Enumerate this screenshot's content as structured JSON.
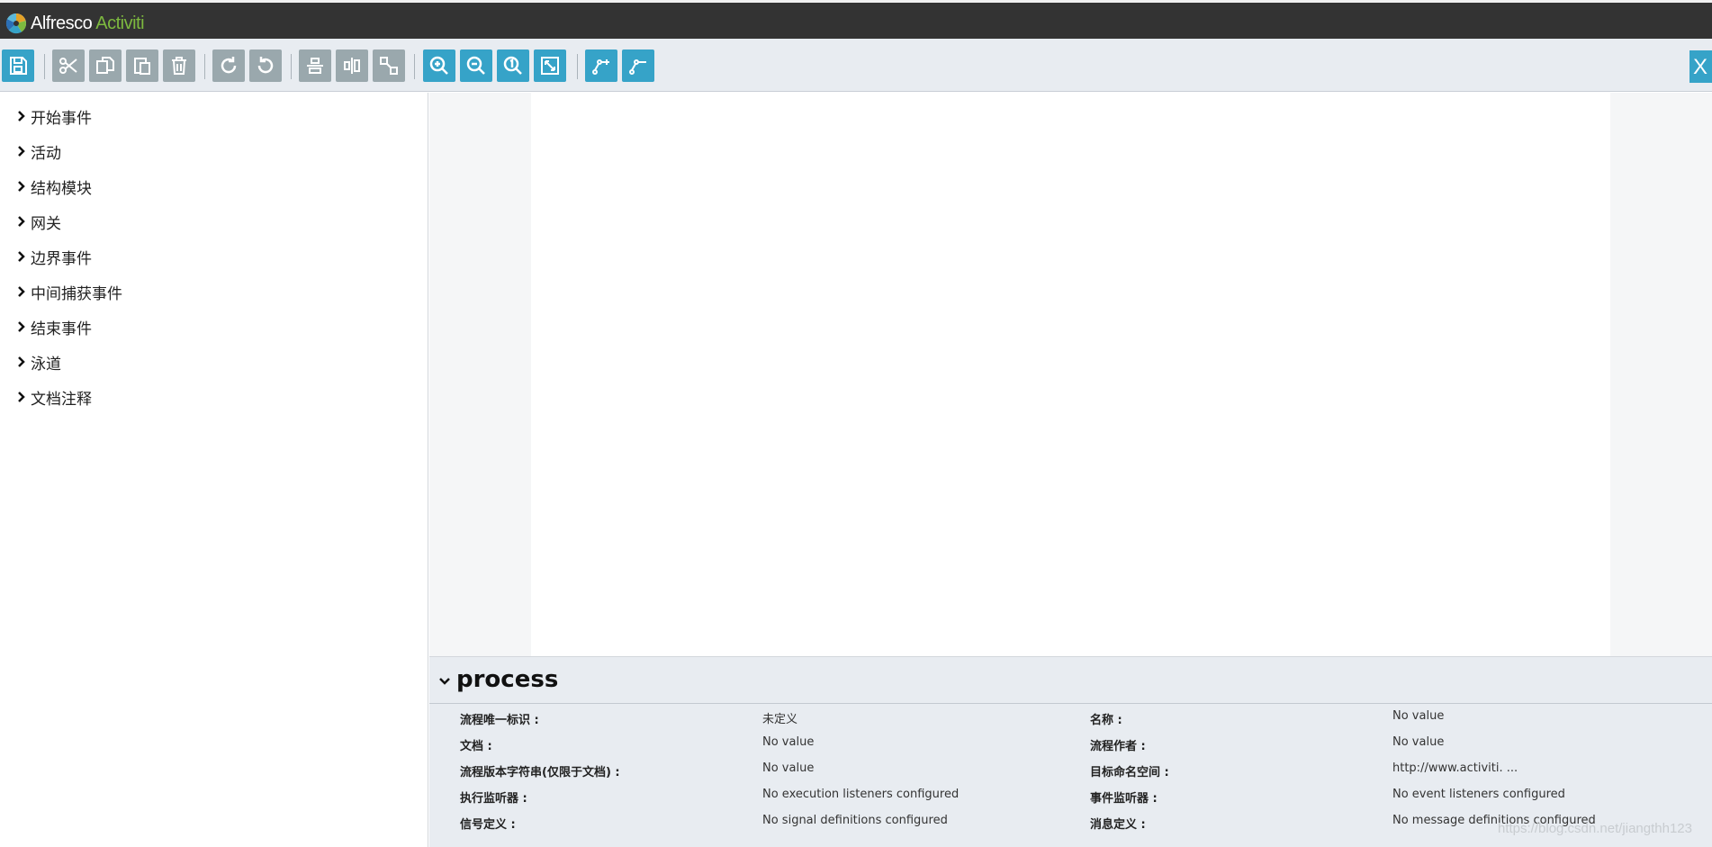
{
  "header": {
    "brand_main": "Alfresco",
    "brand_accent": "Activiti",
    "accent_color": "#7db93f"
  },
  "toolbar": {
    "buttons": [
      {
        "name": "save",
        "icon": "floppy-disk-icon"
      },
      {
        "name": "cut",
        "icon": "scissors-icon"
      },
      {
        "name": "copy",
        "icon": "copy-icon"
      },
      {
        "name": "paste",
        "icon": "paste-icon"
      },
      {
        "name": "delete",
        "icon": "trash-icon"
      },
      {
        "name": "redo",
        "icon": "redo-icon"
      },
      {
        "name": "undo",
        "icon": "undo-icon"
      },
      {
        "name": "align-horizontal",
        "icon": "align-horizontal-icon"
      },
      {
        "name": "align-vertical",
        "icon": "align-vertical-icon"
      },
      {
        "name": "same-size",
        "icon": "same-size-icon"
      },
      {
        "name": "zoom-in",
        "icon": "zoom-in-icon"
      },
      {
        "name": "zoom-out",
        "icon": "zoom-out-icon"
      },
      {
        "name": "zoom-actual",
        "icon": "zoom-actual-icon"
      },
      {
        "name": "zoom-fit",
        "icon": "zoom-fit-icon"
      },
      {
        "name": "add-bendpoint",
        "icon": "add-bendpoint-icon"
      },
      {
        "name": "remove-bendpoint",
        "icon": "remove-bendpoint-icon"
      }
    ],
    "close_label": "X"
  },
  "palette": {
    "items": [
      "开始事件",
      "活动",
      "结构模块",
      "网关",
      "边界事件",
      "中间捕获事件",
      "结束事件",
      "泳道",
      "文档注释"
    ]
  },
  "properties": {
    "title": "process",
    "left": [
      {
        "label": "流程唯一标识 :",
        "value": "未定义"
      },
      {
        "label": "文档 :",
        "value": "No value"
      },
      {
        "label": "流程版本字符串(仅限于文档) :",
        "value": "No value"
      },
      {
        "label": "执行监听器 :",
        "value": "No execution listeners configured"
      },
      {
        "label": "信号定义 :",
        "value": "No signal definitions configured"
      }
    ],
    "right": [
      {
        "label": "名称 :",
        "value": "No value"
      },
      {
        "label": "流程作者 :",
        "value": "No value"
      },
      {
        "label": "目标命名空间 :",
        "value": "http://www.activiti. ..."
      },
      {
        "label": "事件监听器 :",
        "value": "No event listeners configured"
      },
      {
        "label": "消息定义 :",
        "value": "No message definitions configured"
      }
    ]
  },
  "watermark": "https://blog.csdn.net/jiangthh123"
}
